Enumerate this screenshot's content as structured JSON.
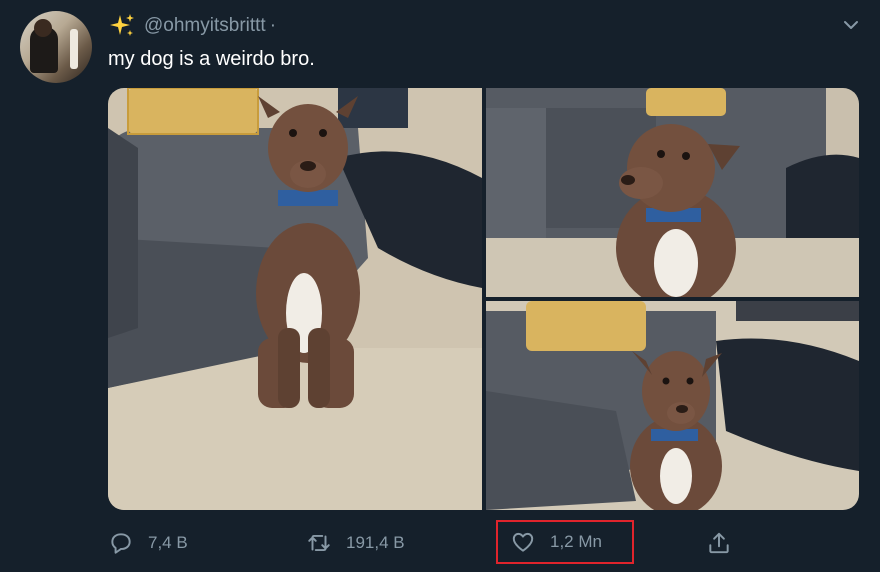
{
  "tweet": {
    "handle": "@ohmyitsbrittt",
    "separator": "·",
    "text": "my dog is a weirdo bro.",
    "media_count": 3
  },
  "actions": {
    "replies": "7,4 B",
    "retweets": "191,4 B",
    "likes": "1,2 Mn"
  },
  "icons": {
    "sparkle": "sparkle-icon",
    "more": "chevron-down-icon",
    "reply": "reply-icon",
    "retweet": "retweet-icon",
    "like": "heart-icon",
    "share": "share-icon"
  },
  "colors": {
    "background": "#15202b",
    "muted_text": "#8899a6",
    "highlight_box": "#e0242c",
    "sparkle": "#ffd23f"
  }
}
